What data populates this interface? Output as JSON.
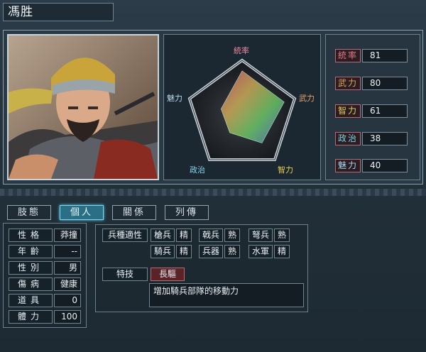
{
  "name": "馮胜",
  "stats": [
    {
      "label": "統率",
      "value": "81",
      "color": "#e57780"
    },
    {
      "label": "武力",
      "value": "80",
      "color": "#e6a455"
    },
    {
      "label": "智力",
      "value": "61",
      "color": "#e7cf4f"
    },
    {
      "label": "政治",
      "value": "38",
      "color": "#7fd0e0"
    },
    {
      "label": "魅力",
      "value": "40",
      "color": "#a7d8f0"
    }
  ],
  "radar_labels": {
    "top": "統率",
    "right": "武力",
    "bottom_right": "智力",
    "bottom_left": "政治",
    "left": "魅力"
  },
  "tabs": [
    "肢態",
    "個人",
    "關係",
    "列傳"
  ],
  "active_tab": "個人",
  "info": [
    {
      "label": "性格",
      "value": "莽撞"
    },
    {
      "label": "年齡",
      "value": "--"
    },
    {
      "label": "性別",
      "value": "男"
    },
    {
      "label": "傷病",
      "value": "健康"
    },
    {
      "label": "道具",
      "value": "0"
    },
    {
      "label": "體力",
      "value": "100"
    }
  ],
  "troops": {
    "title": "兵種適性",
    "rows": [
      [
        {
          "type": "槍兵",
          "apt": "精"
        },
        {
          "type": "戟兵",
          "apt": "熟"
        },
        {
          "type": "弩兵",
          "apt": "熟"
        }
      ],
      [
        {
          "type": "騎兵",
          "apt": "精"
        },
        {
          "type": "兵器",
          "apt": "熟"
        },
        {
          "type": "水軍",
          "apt": "精"
        }
      ]
    ]
  },
  "skill": {
    "label": "特技",
    "name": "長驅",
    "desc": "增加騎兵部隊的移動力"
  }
}
